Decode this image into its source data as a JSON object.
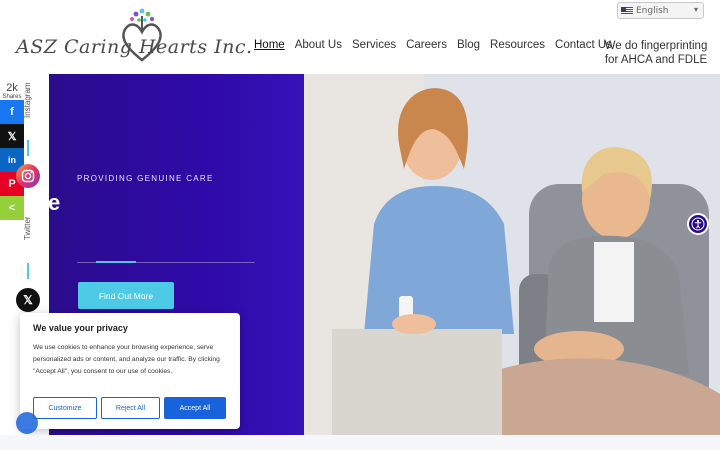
{
  "header": {
    "logo_text": "ASZ Caring Hearts Inc.",
    "language": "English",
    "nav": [
      {
        "label": "Home",
        "active": true
      },
      {
        "label": "About Us"
      },
      {
        "label": "Services"
      },
      {
        "label": "Careers"
      },
      {
        "label": "Blog"
      },
      {
        "label": "Resources"
      },
      {
        "label": "Contact Us"
      }
    ],
    "nav_extra_line1": "We do fingerprinting",
    "nav_extra_line2": "for AHCA and FDLE"
  },
  "hero": {
    "tagline": "PROVIDING GENUINE CARE",
    "partial_heading": "e",
    "cta_label": "Find Out More",
    "accent_color": "#4dcbe6",
    "panel_color": "#2f0aa8"
  },
  "share": {
    "count": "2k",
    "count_label": "Shares",
    "buttons": [
      {
        "name": "facebook",
        "glyph": "f",
        "color": "#1877f2"
      },
      {
        "name": "x",
        "glyph": "𝕏",
        "color": "#111111"
      },
      {
        "name": "linkedin",
        "glyph": "in",
        "color": "#0a66c2"
      },
      {
        "name": "pinterest",
        "glyph": "P",
        "color": "#e60023"
      },
      {
        "name": "sharethis",
        "glyph": "<",
        "color": "#95d03a"
      }
    ],
    "instagram_label": "Instagram",
    "twitter_label": "Twitter"
  },
  "cookie": {
    "title": "We value your privacy",
    "body": "We use cookies to enhance your browsing experience, serve personalized ads or content, and analyze our traffic. By clicking \"Accept All\", you consent to our use of cookies.",
    "customize": "Customize",
    "reject": "Reject All",
    "accept": "Accept All"
  }
}
